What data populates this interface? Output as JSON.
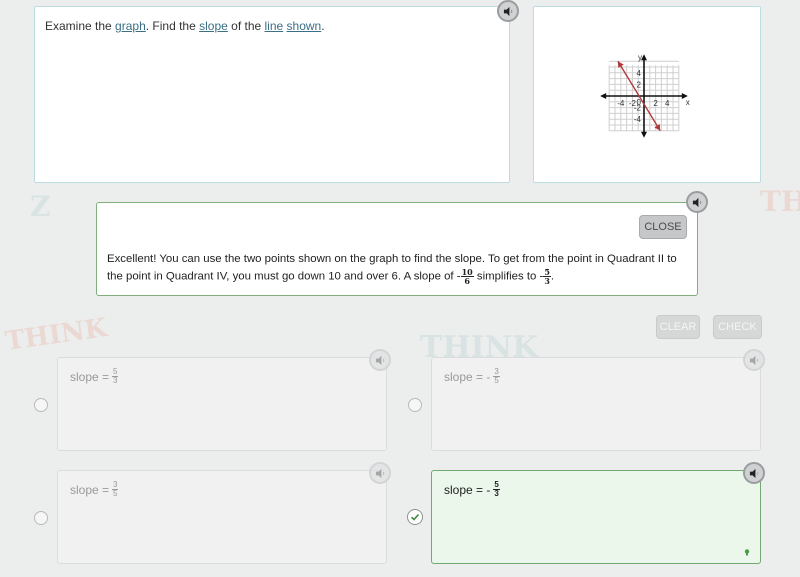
{
  "prompt": {
    "parts": [
      {
        "text": "Examine the ",
        "link": false
      },
      {
        "text": "graph",
        "link": true
      },
      {
        "text": ". Find the ",
        "link": false
      },
      {
        "text": "slope",
        "link": true
      },
      {
        "text": " of the ",
        "link": false
      },
      {
        "text": "line",
        "link": true
      },
      {
        "text": " ",
        "link": false
      },
      {
        "text": "shown",
        "link": true
      },
      {
        "text": ".",
        "link": false
      }
    ],
    "audio_icon": "speaker-icon"
  },
  "graph": {
    "x_axis_label": "x",
    "y_axis_label": "y",
    "x_ticks": [
      "-4",
      "-2",
      "2",
      "4"
    ],
    "y_ticks": [
      "4",
      "2",
      "-2",
      "-4"
    ],
    "origin_label": "0",
    "range": {
      "xmin": -6,
      "xmax": 6,
      "ymin": -6,
      "ymax": 6
    },
    "line": {
      "x1": -4.5,
      "y1": 6,
      "x2": 2.8,
      "y2": -6
    },
    "line_color": "#b0393a",
    "axis_color": "#111111",
    "grid_color": "#cfcfcf"
  },
  "feedback": {
    "close_label": "CLOSE",
    "text_before": "Excellent! You can use the two points shown on the graph to find the slope. To get from the point in Quadrant II to the point in Quadrant IV, you must go down 10 and over 6. A slope of -",
    "frac1": {
      "num": "10",
      "den": "6"
    },
    "text_middle": " simplifies to -",
    "frac2": {
      "num": "5",
      "den": "3"
    },
    "text_after": ".",
    "accent_color": "#7fb07c"
  },
  "actions": {
    "clear_label": "CLEAR",
    "check_label": "CHECK"
  },
  "options": [
    {
      "prefix": "slope = ",
      "sign": "",
      "num": "5",
      "den": "3",
      "selected": false
    },
    {
      "prefix": "slope = ",
      "sign": "-",
      "num": "3",
      "den": "5",
      "selected": false
    },
    {
      "prefix": "slope = ",
      "sign": "",
      "num": "3",
      "den": "5",
      "selected": false
    },
    {
      "prefix": "slope = ",
      "sign": "-",
      "num": "5",
      "den": "3",
      "selected": true
    }
  ]
}
